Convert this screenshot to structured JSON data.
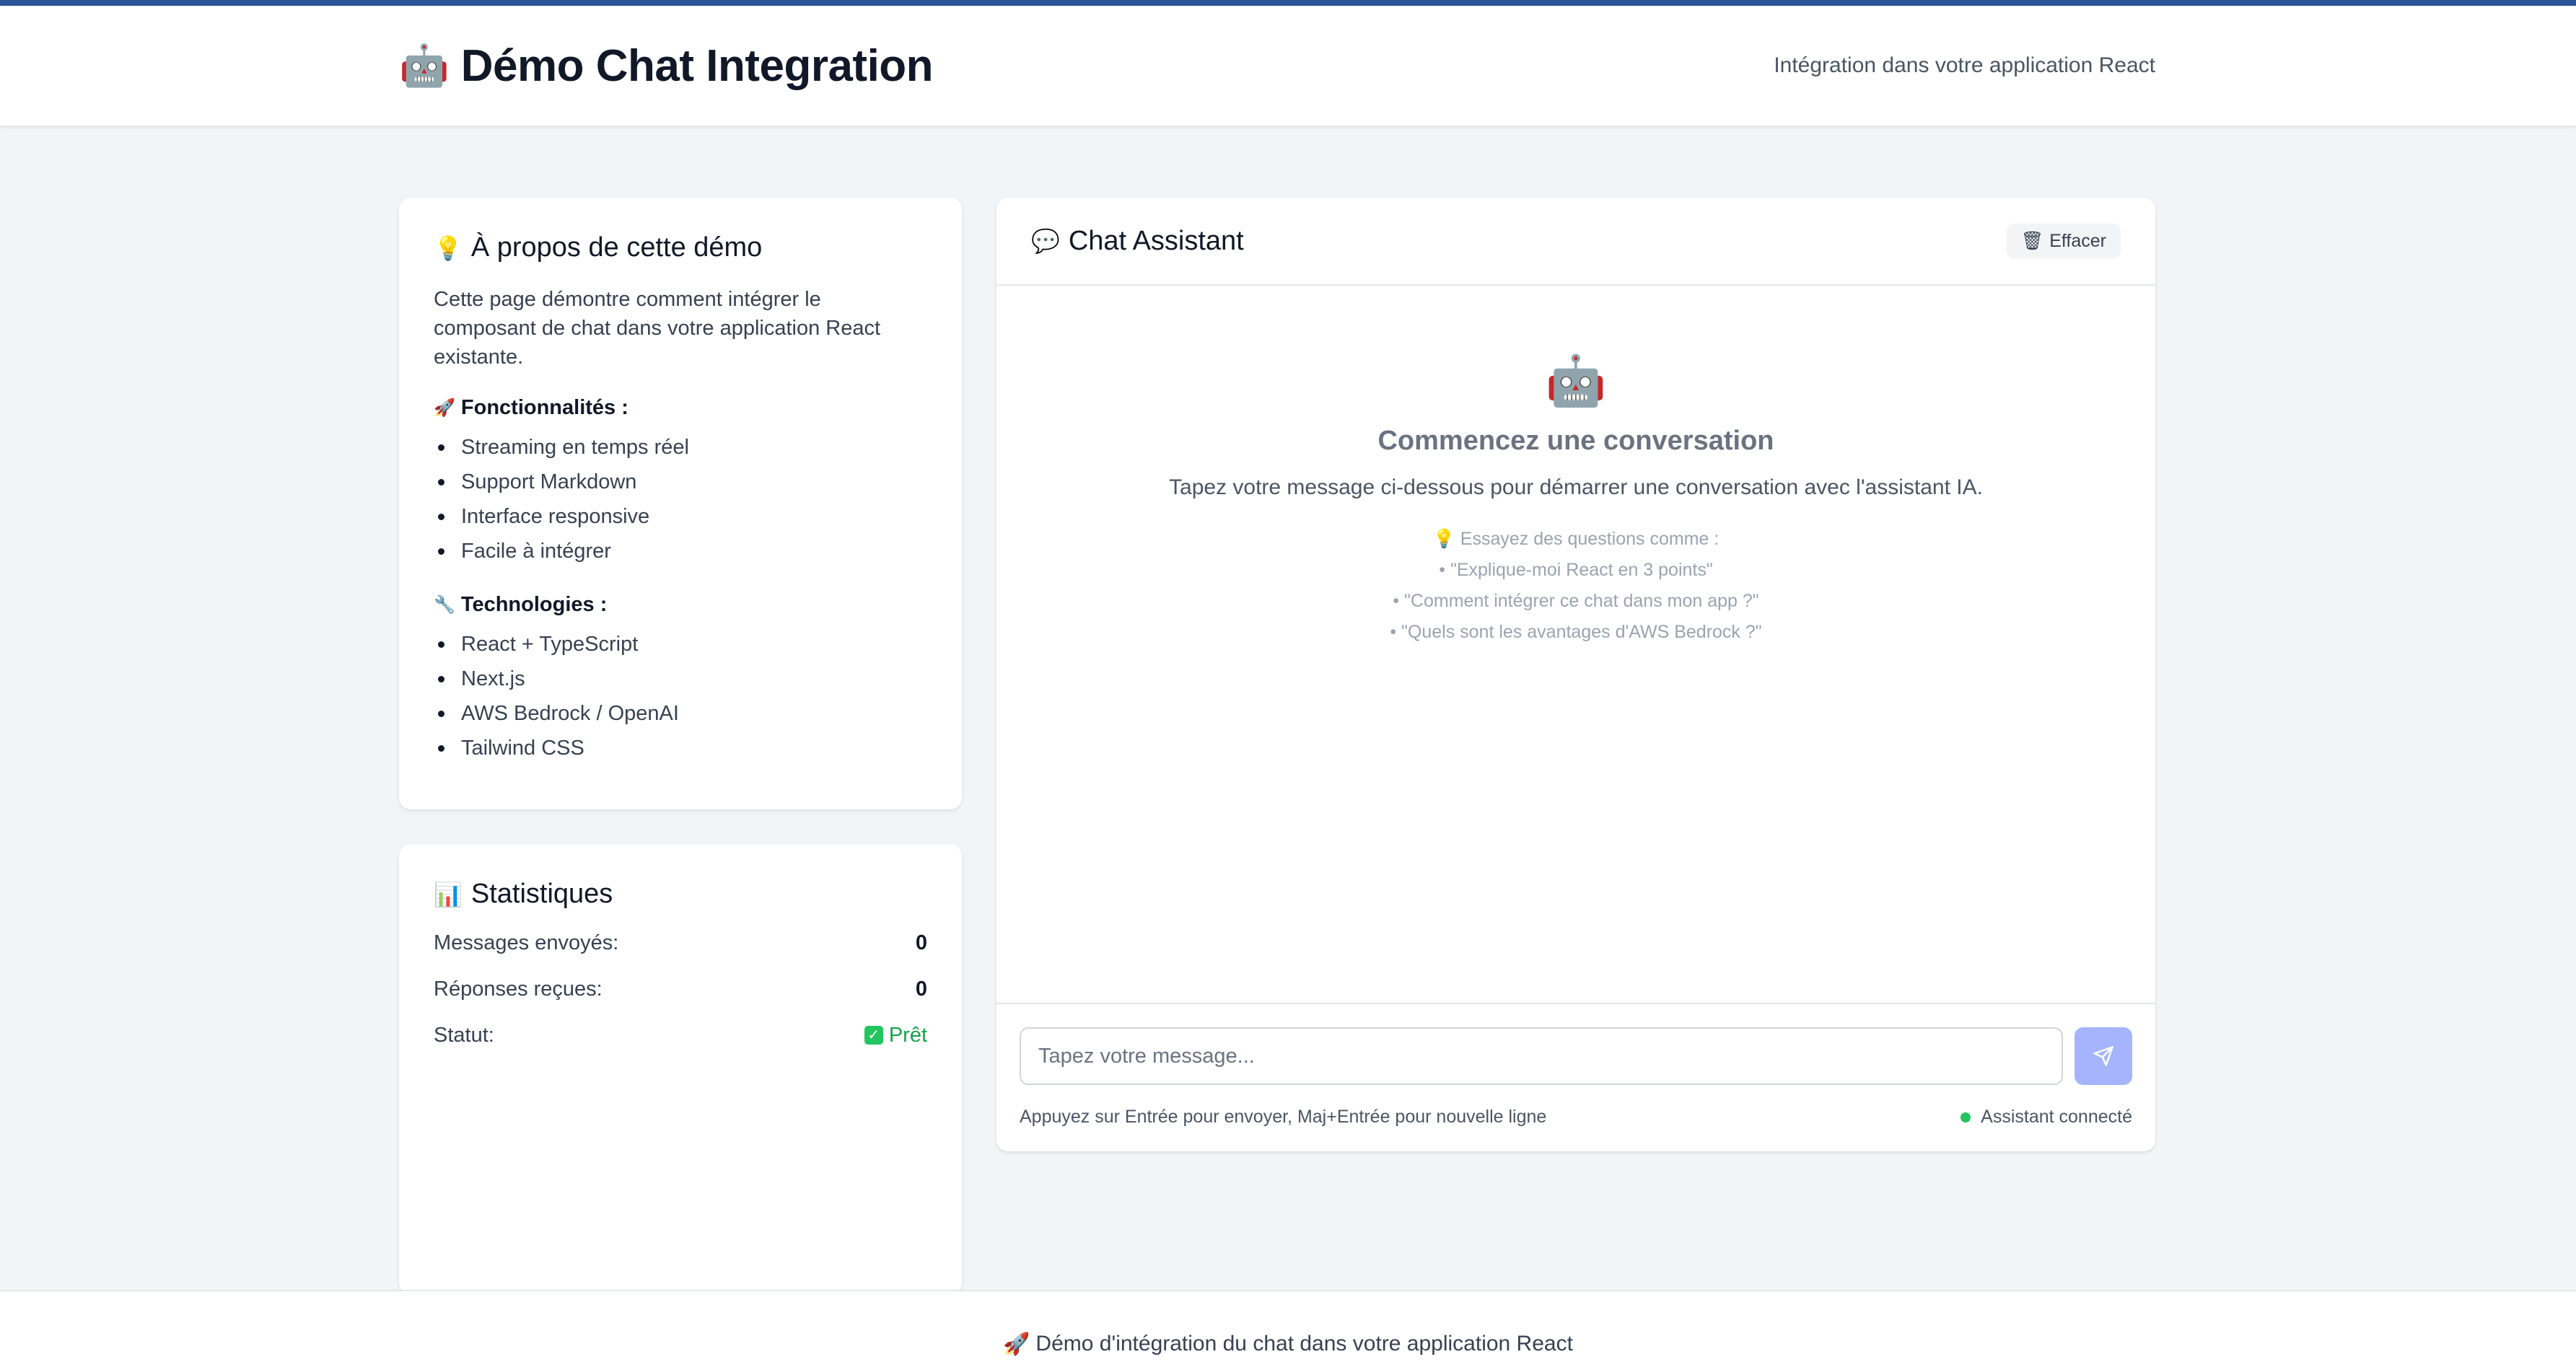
{
  "header": {
    "title": "Démo Chat Integration",
    "robot_icon": "🤖",
    "subtitle": "Intégration dans votre application React"
  },
  "about": {
    "icon": "💡",
    "title": "À propos de cette démo",
    "description": "Cette page démontre comment intégrer le composant de chat dans votre application React existante.",
    "features_icon": "🚀",
    "features_title": "Fonctionnalités :",
    "features": [
      "Streaming en temps réel",
      "Support Markdown",
      "Interface responsive",
      "Facile à intégrer"
    ],
    "tech_icon": "🔧",
    "tech_title": "Technologies :",
    "technologies": [
      "React + TypeScript",
      "Next.js",
      "AWS Bedrock / OpenAI",
      "Tailwind CSS"
    ]
  },
  "stats": {
    "icon": "📊",
    "title": "Statistiques",
    "rows": [
      {
        "label": "Messages envoyés:",
        "value": "0"
      },
      {
        "label": "Réponses reçues:",
        "value": "0"
      }
    ],
    "status_label": "Statut:",
    "status_value": "Prêt",
    "status_color": "#16a34a"
  },
  "chat": {
    "icon": "💬",
    "title": "Chat Assistant",
    "clear_icon": "🗑",
    "clear_label": "Effacer",
    "welcome_icon": "🤖",
    "welcome_title": "Commencez une conversation",
    "welcome_sub": "Tapez votre message ci-dessous pour démarrer une conversation avec l'assistant IA.",
    "tips_icon": "💡",
    "tips_title": "Essayez des questions comme :",
    "tips": [
      "• \"Explique-moi React en 3 points\"",
      "• \"Comment intégrer ce chat dans mon app ?\"",
      "• \"Quels sont les avantages d'AWS Bedrock ?\""
    ],
    "input_placeholder": "Tapez votre message...",
    "input_value": "",
    "hint": "Appuyez sur Entrée pour envoyer, Maj+Entrée pour nouvelle ligne",
    "status": "Assistant connecté",
    "send_icon": "send-icon",
    "accent": "#a5b4fc"
  },
  "footer": {
    "icon": "🚀",
    "text": "Démo d'intégration du chat dans votre application React"
  },
  "colors": {
    "topbar": "#2b5597",
    "success": "#22c55e"
  }
}
